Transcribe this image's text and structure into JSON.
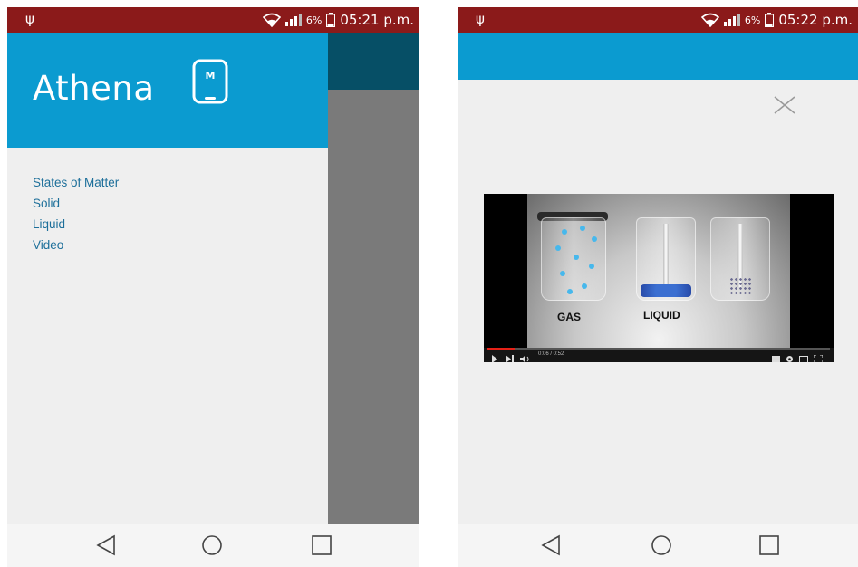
{
  "left_screen": {
    "status": {
      "battery": "6%",
      "time": "05:21 p.m."
    },
    "app": {
      "title": "Athena",
      "logo_letter": "M"
    },
    "menu": [
      {
        "label": "States of Matter"
      },
      {
        "label": "Solid"
      },
      {
        "label": "Liquid"
      },
      {
        "label": "Video"
      }
    ]
  },
  "right_screen": {
    "status": {
      "battery": "6%",
      "time": "05:22 p.m."
    },
    "video": {
      "labels": {
        "gas": "GAS",
        "liquid": "LIQUID"
      },
      "time": "0:06 / 0:52",
      "progress": 0.08
    }
  },
  "colors": {
    "status_bar": "#8b1a1a",
    "brand_blue": "#0b9bd0",
    "link": "#1d6f9a",
    "scrim": "#7a7a7a"
  },
  "icons": [
    "usb-icon",
    "wifi-icon",
    "signal-icon",
    "battery-icon",
    "phone-m-logo-icon",
    "close-icon",
    "back-icon",
    "home-icon",
    "recents-icon"
  ]
}
